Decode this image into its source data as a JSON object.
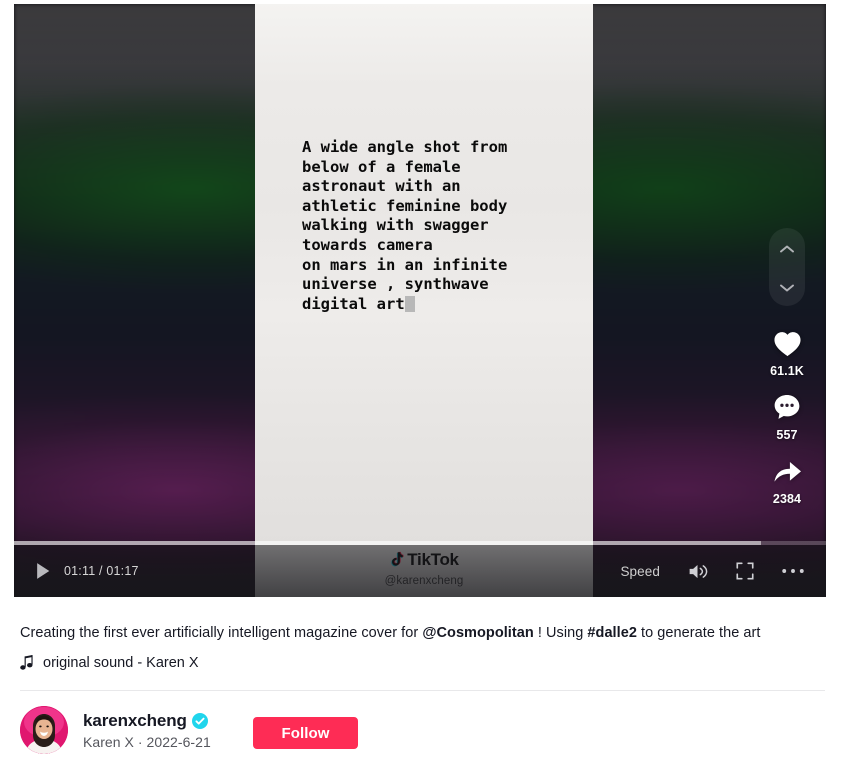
{
  "video": {
    "prompt_text": "A wide angle shot from\nbelow of a female\nastronaut with an\nathletic feminine body\nwalking with swagger\ntowards camera\non mars in an infinite\nuniverse , synthwave\ndigital art",
    "watermark_brand": "TikTok",
    "watermark_handle": "@karenxcheng"
  },
  "actions": {
    "prev_icon": "chevron-up-icon",
    "next_icon": "chevron-down-icon",
    "like": {
      "icon": "heart-icon",
      "count": "61.1K"
    },
    "comment": {
      "icon": "comment-icon",
      "count": "557"
    },
    "share": {
      "icon": "share-arrow-icon",
      "count": "2384"
    }
  },
  "controls": {
    "play_icon": "play-icon",
    "current_time": "01:11",
    "duration": "01:17",
    "time_display": "01:11 / 01:17",
    "speed_label": "Speed",
    "volume_icon": "volume-on-icon",
    "fullscreen_icon": "fullscreen-icon",
    "more_icon": "more-options-icon",
    "progress_percent": 92
  },
  "meta": {
    "caption_part1": "Creating the first ever artificially intelligent magazine cover for ",
    "caption_mention": "@Cosmopolitan",
    "caption_part2": " ! Using ",
    "caption_hashtag": "#dalle2",
    "caption_part3": " to generate the art",
    "music_icon": "music-note-icon",
    "music_label": "original sound - Karen X"
  },
  "author": {
    "avatar_name": "user-avatar",
    "username": "karenxcheng",
    "verified_icon": "verified-badge-icon",
    "display_name_and_date": "Karen X · 2022-6-21",
    "follow_label": "Follow"
  },
  "colors": {
    "accent_red": "#fe2c55",
    "verified_blue": "#20d5ec",
    "text_primary": "#161823"
  }
}
